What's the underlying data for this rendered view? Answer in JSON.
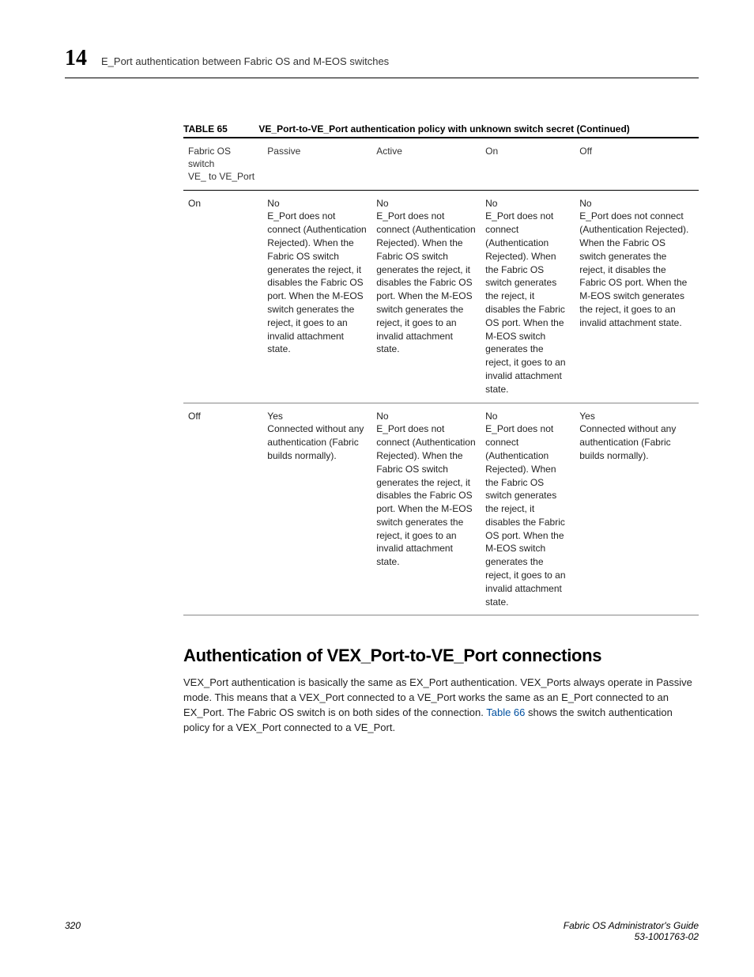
{
  "header": {
    "chapter_number": "14",
    "running_title": "E_Port authentication between Fabric OS and M-EOS switches"
  },
  "table": {
    "label": "TABLE 65",
    "title": "VE_Port-to-VE_Port authentication policy with unknown switch secret (Continued)",
    "columns": [
      "Fabric OS switch\nVE_ to VE_Port",
      "Passive",
      "Active",
      "On",
      "Off"
    ],
    "rows": [
      {
        "rowhead": "On",
        "cells": [
          "No\nE_Port does not connect (Authentication Rejected). When the Fabric OS switch generates the reject, it disables the Fabric OS port. When the M-EOS switch generates the reject, it goes to an invalid attachment state.",
          "No\nE_Port does not connect (Authentication Rejected). When the Fabric OS switch generates the reject, it disables the Fabric OS port. When the M-EOS switch generates the reject, it goes to an invalid attachment state.",
          "No\nE_Port does not connect (Authentication Rejected). When the Fabric OS switch generates the reject, it disables the Fabric OS port. When the M-EOS switch generates the reject, it goes to an invalid attachment state.",
          "No\nE_Port does not connect (Authentication Rejected). When the Fabric OS switch generates the reject, it disables the Fabric OS port. When the M-EOS switch generates the reject, it goes to an invalid attachment state."
        ]
      },
      {
        "rowhead": "Off",
        "cells": [
          "Yes\nConnected without any authentication (Fabric builds normally).",
          "No\nE_Port does not connect (Authentication Rejected). When the Fabric OS switch generates the reject, it disables the Fabric OS port. When the M-EOS switch generates the reject, it goes to an invalid attachment state.",
          "No\nE_Port does not connect (Authentication Rejected). When the Fabric OS switch generates the reject, it disables the Fabric OS port. When the M-EOS switch generates the reject, it goes to an invalid attachment state.",
          "Yes\nConnected without any authentication (Fabric builds normally)."
        ]
      }
    ]
  },
  "section": {
    "heading": "Authentication of VEX_Port-to-VE_Port connections",
    "para_pre": "VEX_Port authentication is basically the same as EX_Port authentication. VEX_Ports always operate in Passive mode. This means that a VEX_Port connected to a VE_Port works the same as an E_Port connected to an EX_Port. The Fabric OS switch is on both sides of the connection. ",
    "link_text": "Table 66",
    "para_post": " shows the switch authentication policy for a VEX_Port connected to a VE_Port."
  },
  "footer": {
    "page": "320",
    "doc_title": "Fabric OS Administrator's Guide",
    "doc_number": "53-1001763-02"
  }
}
